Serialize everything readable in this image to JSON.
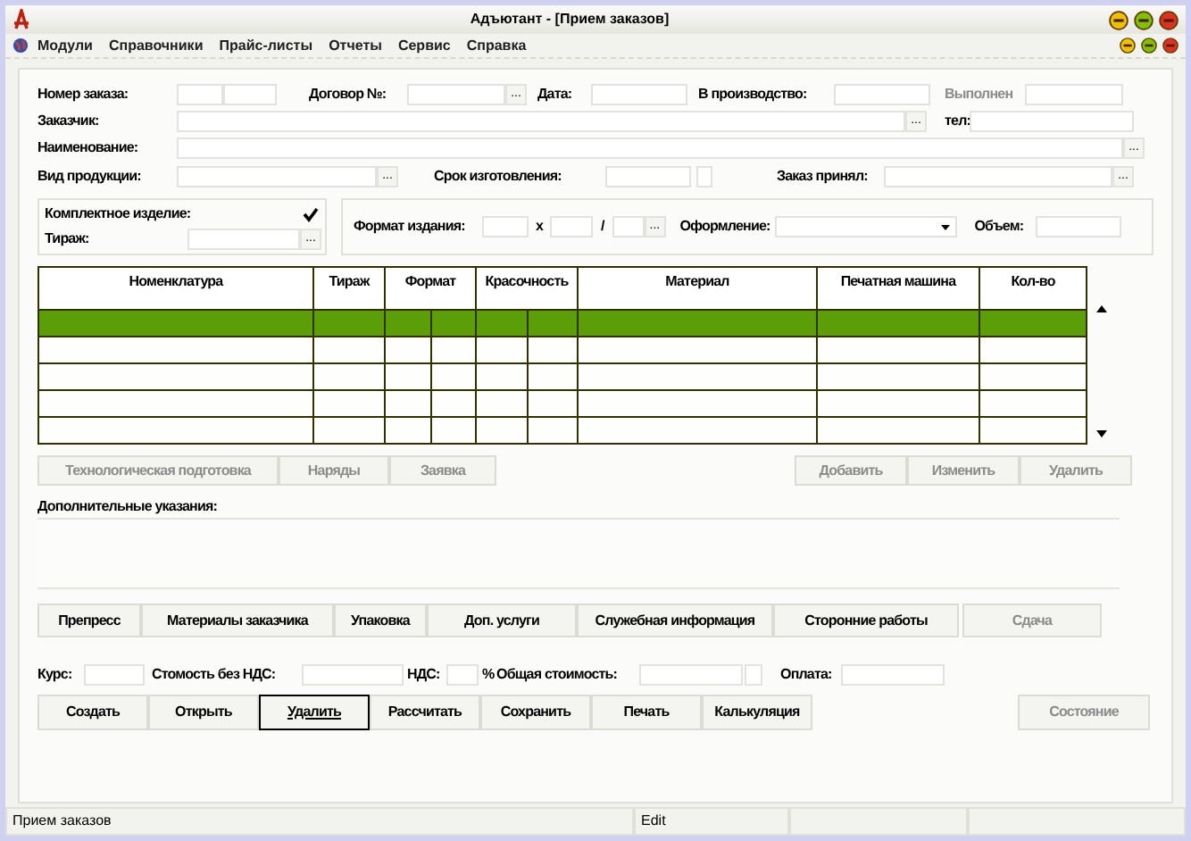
{
  "window": {
    "title": "Адъютант - [Прием заказов]"
  },
  "menu": [
    "Модули",
    "Справочники",
    "Прайс-листы",
    "Отчеты",
    "Сервис",
    "Справка"
  ],
  "header": {
    "order_number": {
      "label": "Номер заказа:"
    },
    "contract": {
      "label": "Договор №:",
      "button": "..."
    },
    "date": {
      "label": "Дата:"
    },
    "in_production": {
      "label": "В производство:"
    },
    "completed": {
      "label": "Выполнен",
      "disabled": true
    },
    "customer": {
      "label": "Заказчик:",
      "button": "..."
    },
    "phone": {
      "label": "тел:"
    },
    "name": {
      "label": "Наименование:",
      "button": "..."
    },
    "product_type": {
      "label": "Вид продукции:",
      "button": "..."
    },
    "deadline": {
      "label": "Срок изготовления:"
    },
    "accepted_by": {
      "label": "Заказ принял:",
      "button": "..."
    }
  },
  "complete_item": {
    "label": "Комплектное изделие:",
    "checked": true
  },
  "print_run": {
    "label": "Тираж:",
    "button": "..."
  },
  "format": {
    "label": "Формат издания:",
    "separators": [
      "x",
      "/"
    ],
    "button": "..."
  },
  "design": {
    "label": "Оформление:"
  },
  "volume": {
    "label": "Объем:"
  },
  "table": {
    "columns": [
      {
        "label": "Номенклатура",
        "kind": "single"
      },
      {
        "label": "Тираж",
        "kind": "single"
      },
      {
        "label": "Формат",
        "kind": "split"
      },
      {
        "label": "Красочность",
        "kind": "split"
      },
      {
        "label": "Материал",
        "kind": "single"
      },
      {
        "label": "Печатная машина",
        "kind": "single"
      },
      {
        "label": "Кол-во",
        "kind": "single"
      }
    ],
    "rows": [
      {
        "selected": true
      },
      {
        "selected": false
      },
      {
        "selected": false
      },
      {
        "selected": false
      },
      {
        "selected": false
      }
    ]
  },
  "row_actions_left": [
    {
      "label": "Технологическая подготовка",
      "disabled": true
    },
    {
      "label": "Наряды",
      "disabled": true
    },
    {
      "label": "Заявка",
      "disabled": true
    }
  ],
  "row_actions_right": [
    {
      "label": "Добавить",
      "disabled": true
    },
    {
      "label": "Изменить",
      "disabled": true
    },
    {
      "label": "Удалить",
      "disabled": true
    }
  ],
  "notes": {
    "label": "Дополнительные указания:"
  },
  "sections": [
    {
      "label": "Препресс",
      "disabled": false
    },
    {
      "label": "Материалы заказчика",
      "disabled": false
    },
    {
      "label": "Упаковка",
      "disabled": false
    },
    {
      "label": "Доп. услуги",
      "disabled": false
    },
    {
      "label": "Служебная информация",
      "disabled": false
    },
    {
      "label": "Сторонние работы",
      "disabled": false
    },
    {
      "label": "Сдача",
      "disabled": true
    }
  ],
  "costs": {
    "rate": "Курс:",
    "net": "Стомость без НДС:",
    "vat": "НДС:",
    "percent": "%",
    "total": "Общая стоимость:",
    "payment": "Оплата:"
  },
  "buttons": [
    {
      "label": "Создать",
      "focused": false
    },
    {
      "label": "Открыть",
      "focused": false
    },
    {
      "label": "Удалить",
      "focused": true
    },
    {
      "label": "Рассчитать",
      "focused": false
    },
    {
      "label": "Сохранить",
      "focused": false
    },
    {
      "label": "Печать",
      "focused": false
    },
    {
      "label": "Калькуляция",
      "focused": false
    }
  ],
  "state_button": {
    "label": "Состояние",
    "disabled": true
  },
  "status_bar": [
    "Прием заказов",
    "Edit"
  ]
}
